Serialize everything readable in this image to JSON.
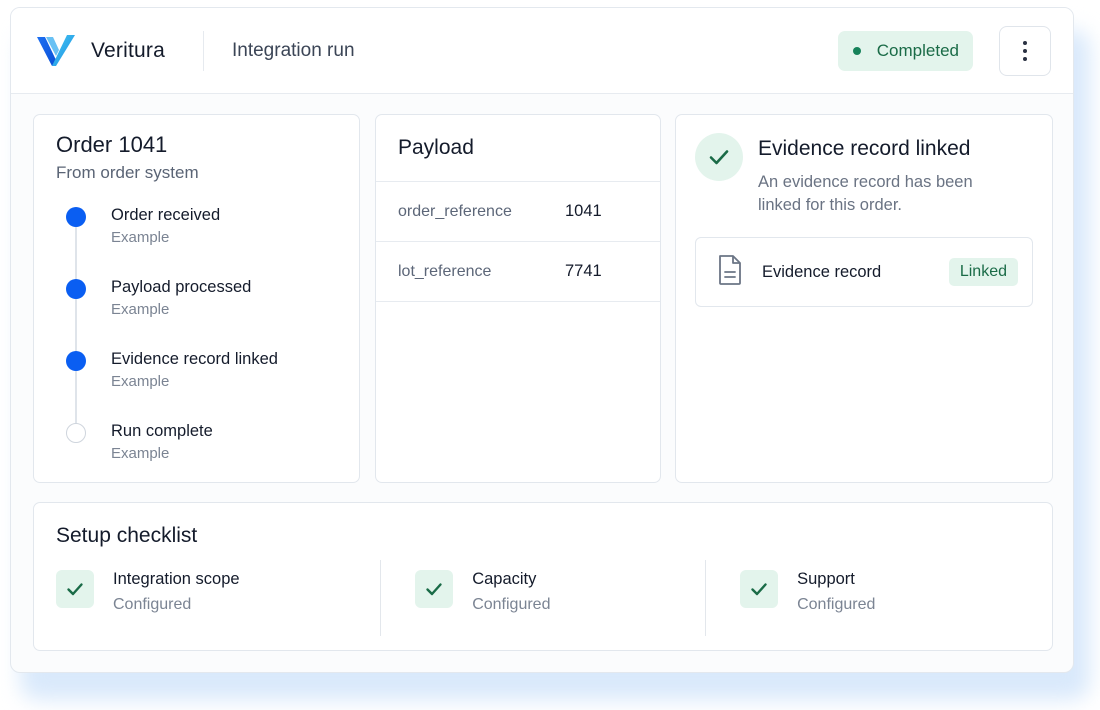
{
  "colors": {
    "brand_accent": "#0a5ef2",
    "success_bg": "#e3f4ec",
    "success_text": "#1a6b47"
  },
  "header": {
    "brand": "Veritura",
    "logo_icon": "veritura-v-logo-icon",
    "title": "Integration run",
    "status": "Completed",
    "menu_icon": "more-vertical-icon"
  },
  "order": {
    "title": "Order 1041",
    "subtitle": "From order system",
    "steps": [
      {
        "label": "Order received",
        "note": "Example",
        "state": "done"
      },
      {
        "label": "Payload processed",
        "note": "Example",
        "state": "done"
      },
      {
        "label": "Evidence record linked",
        "note": "Example",
        "state": "done"
      },
      {
        "label": "Run complete",
        "note": "Example",
        "state": "pending"
      }
    ]
  },
  "payload": {
    "title": "Payload",
    "rows": [
      {
        "key": "order_reference",
        "value": "1041"
      },
      {
        "key": "lot_reference",
        "value": "7741"
      }
    ]
  },
  "evidence": {
    "title": "Evidence record linked",
    "description": "An evidence record has been linked for this order.",
    "check_icon": "check-circle-icon",
    "record": {
      "icon": "document-icon",
      "label": "Evidence record",
      "badge": "Linked"
    }
  },
  "setup": {
    "title": "Setup checklist",
    "items": [
      {
        "label": "Integration scope",
        "status": "Configured",
        "icon": "check-icon"
      },
      {
        "label": "Capacity",
        "status": "Configured",
        "icon": "check-icon"
      },
      {
        "label": "Support",
        "status": "Configured",
        "icon": "check-icon"
      }
    ]
  }
}
